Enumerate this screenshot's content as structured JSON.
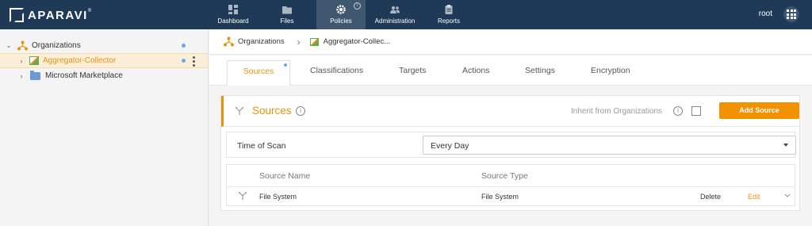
{
  "app": {
    "logo_text": "APARAVI",
    "logo_mark": "®"
  },
  "nav": {
    "tabs": [
      {
        "label": "Dashboard",
        "icon": "dashboard-icon"
      },
      {
        "label": "Files",
        "icon": "folder-icon"
      },
      {
        "label": "Policies",
        "icon": "gear-icon"
      },
      {
        "label": "Administration",
        "icon": "users-icon"
      },
      {
        "label": "Reports",
        "icon": "clipboard-icon"
      }
    ],
    "active_tab": "Policies",
    "policies_info": "i"
  },
  "user": {
    "name": "root"
  },
  "sidebar": {
    "items": [
      {
        "label": "Organizations",
        "caret": "⌄"
      },
      {
        "label": "Aggregator-Collector",
        "caret": "›"
      },
      {
        "label": "Microsoft Marketplace",
        "caret": "›"
      }
    ]
  },
  "breadcrumb": {
    "root": "Organizations",
    "separator": "›",
    "current": "Aggregator-Collec..."
  },
  "tabs": {
    "items": [
      "Sources",
      "Classifications",
      "Targets",
      "Actions",
      "Settings",
      "Encryption"
    ],
    "active": "Sources"
  },
  "panel": {
    "title": "Sources",
    "info": "i",
    "inherit_label": "Inherit from Organizations",
    "inherit_info": "i",
    "inherit_checked": false,
    "add_button": "Add Source"
  },
  "scan": {
    "label": "Time of Scan",
    "value": "Every Day"
  },
  "table": {
    "headers": [
      "Source Name",
      "Source Type"
    ],
    "rows": [
      {
        "name": "File System",
        "type": "File System",
        "delete": "Delete",
        "edit": "Edit"
      }
    ]
  },
  "colors": {
    "topbar": "#1f3a57",
    "accent": "#f39200",
    "selected_bg": "#fcefd9"
  }
}
